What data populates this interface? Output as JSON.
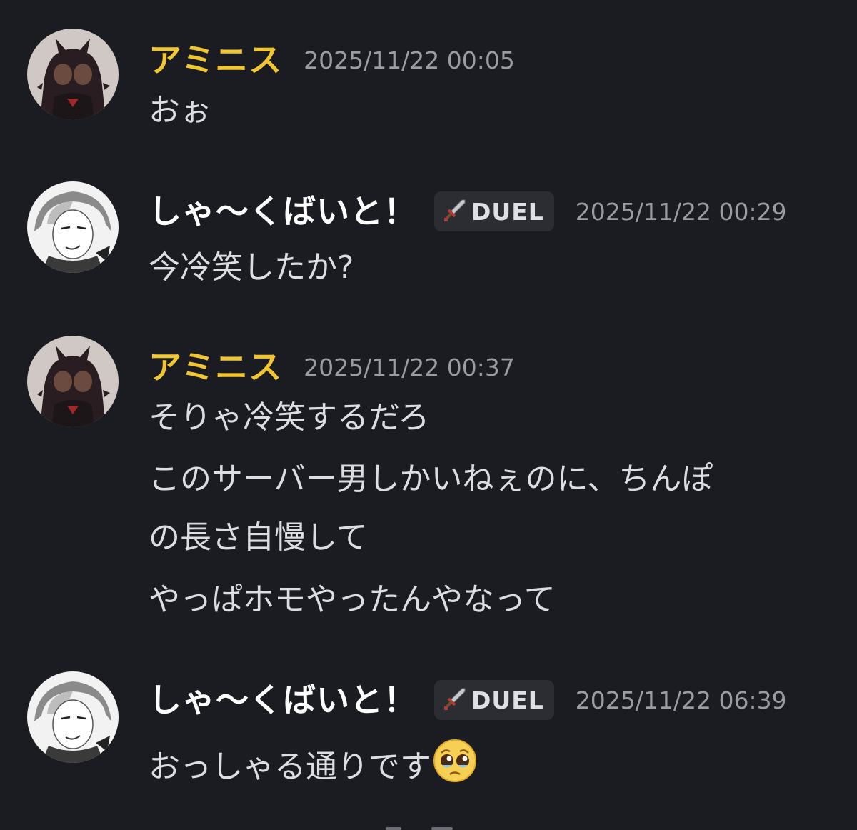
{
  "messages": [
    {
      "user": "アミニス",
      "timestamp": "2025/11/22 00:05",
      "lines": [
        "おぉ"
      ]
    },
    {
      "user": "しゃ〜くばいと！",
      "tag": "DUEL",
      "timestamp": "2025/11/22 00:29",
      "lines": [
        "今冷笑したか?"
      ]
    },
    {
      "user": "アミニス",
      "timestamp": "2025/11/22 00:37",
      "lines": [
        "そりゃ冷笑するだろ",
        "このサーバー男しかいねぇのに、ちんぽ",
        "の長さ自慢して",
        "やっぱホモやったんやなって"
      ]
    },
    {
      "user": "しゃ〜くばいと！",
      "tag": "DUEL",
      "timestamp": "2025/11/22 06:39",
      "lines": [
        "おっしゃる通りです"
      ],
      "emoji": "pleading-face-emoji"
    }
  ],
  "colors": {
    "background": "#1b1c21",
    "username_role": "#f0c633",
    "username_default": "#ffffff",
    "timestamp": "#9a9ba3",
    "tag_background": "#2b2d33"
  }
}
